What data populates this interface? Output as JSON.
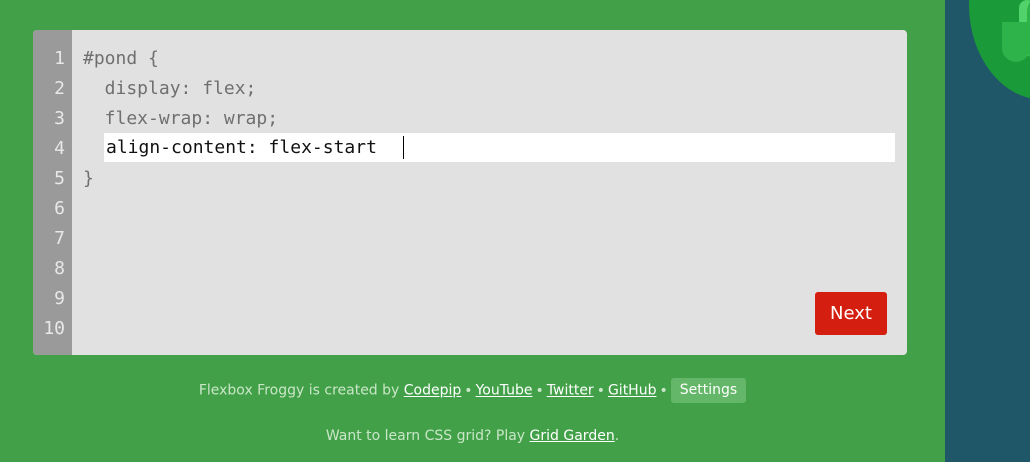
{
  "editor": {
    "line_numbers": [
      "1",
      "2",
      "3",
      "4",
      "5",
      "6",
      "7",
      "8",
      "9",
      "10"
    ],
    "lines": [
      "#pond {",
      "  display: flex;",
      "  flex-wrap: wrap;",
      "}"
    ],
    "input_value": "align-content: flex-start"
  },
  "buttons": {
    "next_label": "Next"
  },
  "footer": {
    "credits_prefix": "Flexbox Froggy is created by ",
    "links": [
      "Codepip",
      "YouTube",
      "Twitter",
      "GitHub"
    ],
    "separator": "•",
    "settings_label": "Settings",
    "grid_prefix": "Want to learn CSS grid? Play ",
    "grid_link": "Grid Garden",
    "grid_suffix": "."
  },
  "colors": {
    "left_background": "#42a148",
    "right_background": "#1f5768",
    "editor_background": "#e1e1e1",
    "gutter": "#9a9a9a",
    "next_button": "#d41e0f"
  },
  "icons": {
    "frog": "frog-icon",
    "lilypad": "lilypad-icon"
  }
}
